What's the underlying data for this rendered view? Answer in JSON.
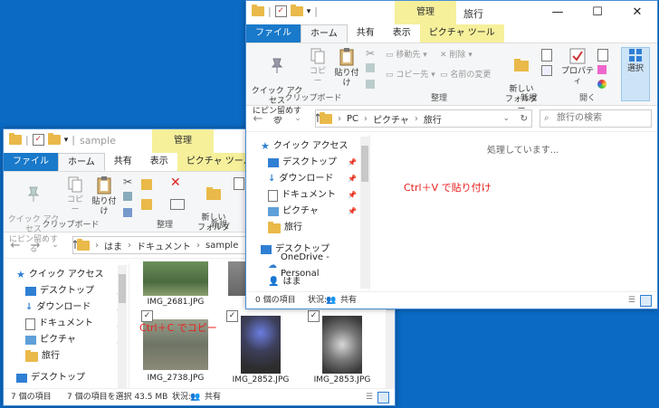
{
  "left_window": {
    "title": "sample",
    "context_tab_top": "管理",
    "tabs": [
      "ファイル",
      "ホーム",
      "共有",
      "表示",
      "ピクチャ ツール"
    ],
    "ribbon": {
      "pin_label": "クイック アクセス\nにピン留めする",
      "copy_label": "コピー",
      "paste_label": "貼り付け",
      "new_folder_label": "新しい\nフォルダー",
      "group_clipboard": "クリップボード",
      "group_organize": "整理",
      "group_new": "新規"
    },
    "breadcrumb": [
      "はま",
      "ドキュメント",
      "sample"
    ],
    "nav": {
      "quick_access": "クイック アクセス",
      "items": [
        "デスクトップ",
        "ダウンロード",
        "ドキュメント",
        "ピクチャ",
        "旅行"
      ],
      "desktop": "デスクトップ"
    },
    "files": [
      "IMG_2681.JPG",
      "",
      "IMG_2738.JPG",
      "IMG_2852.JPG",
      "IMG_2853.JPG"
    ],
    "status": {
      "count": "7 個の項目",
      "selected": "7 個の項目を選択  43.5 MB",
      "state": "状況:",
      "shared": "共有"
    },
    "annotation": "Ctrl＋C  でコピー"
  },
  "right_window": {
    "title": "旅行",
    "context_tab_top": "管理",
    "tabs": [
      "ファイル",
      "ホーム",
      "共有",
      "表示",
      "ピクチャ ツール"
    ],
    "buttons": {
      "minimize": "—",
      "maximize": "☐",
      "close": "✕"
    },
    "ribbon": {
      "pin_label": "クイック アクセス\nにピン留めする",
      "copy_label": "コピー",
      "paste_label": "貼り付け",
      "move_label": "移動先",
      "delete_label": "削除",
      "copyto_label": "コピー先",
      "rename_label": "名前の変更",
      "new_folder_label": "新しい\nフォルダー",
      "properties_label": "プロパティ",
      "select_label": "選択",
      "group_clipboard": "クリップボード",
      "group_organize": "整理",
      "group_new": "新規",
      "group_open": "開く"
    },
    "breadcrumb": [
      "PC",
      "ピクチャ",
      "旅行"
    ],
    "search_placeholder": "旅行の検索",
    "nav": {
      "quick_access": "クイック アクセス",
      "items": [
        "デスクトップ",
        "ダウンロード",
        "ドキュメント",
        "ピクチャ",
        "旅行"
      ],
      "desktop": "デスクトップ",
      "onedrive": "OneDrive - Personal",
      "user": "はま"
    },
    "processing": "処理しています...",
    "status": {
      "count": "0 個の項目",
      "state": "状況:",
      "shared": "共有"
    },
    "annotation": "Ctrl＋V  で貼り付け"
  }
}
